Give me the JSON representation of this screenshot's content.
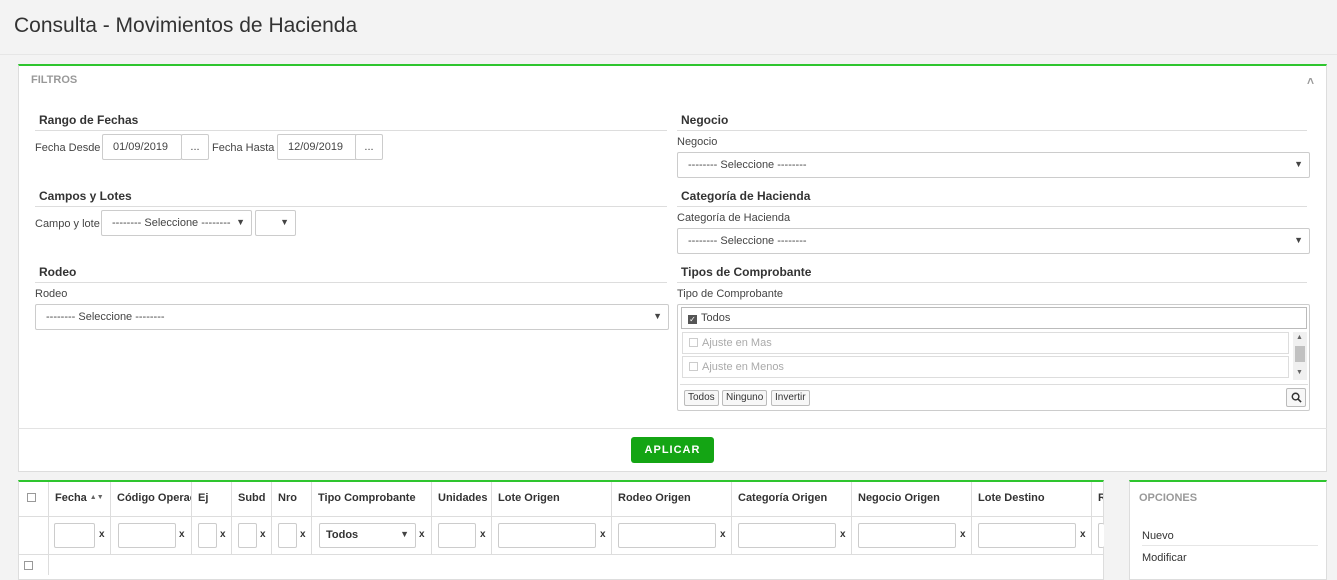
{
  "page": {
    "title": "Consulta - Movimientos de Hacienda"
  },
  "filters": {
    "header": "FILTROS",
    "rango": {
      "title": "Rango de Fechas",
      "desde_label": "Fecha Desde",
      "desde_value": "01/09/2019",
      "hasta_label": "Fecha Hasta",
      "hasta_value": "12/09/2019",
      "picker_label": "..."
    },
    "campos": {
      "title": "Campos y Lotes",
      "label": "Campo y lote",
      "campo_value": "-------- Seleccione --------",
      "lote_value": ""
    },
    "rodeo": {
      "title": "Rodeo",
      "label": "Rodeo",
      "value": "-------- Seleccione --------"
    },
    "negocio": {
      "title": "Negocio",
      "label": "Negocio",
      "value": "-------- Seleccione --------"
    },
    "categoria": {
      "title": "Categoría de Hacienda",
      "label": "Categoría de Hacienda",
      "value": "-------- Seleccione --------"
    },
    "tipos": {
      "title": "Tipos de Comprobante",
      "label": "Tipo de Comprobante",
      "todos_item": "Todos",
      "items": [
        "Ajuste en Mas",
        "Ajuste en Menos"
      ],
      "btn_todos": "Todos",
      "btn_ninguno": "Ninguno",
      "btn_invertir": "Invertir"
    },
    "apply_label": "APLICAR"
  },
  "grid": {
    "columns": [
      "Fecha",
      "Código Operación",
      "Ej",
      "Subd",
      "Nro",
      "Tipo Comprobante",
      "Unidades",
      "Lote Origen",
      "Rodeo Origen",
      "Categoría Origen",
      "Negocio Origen",
      "Lote Destino",
      "R"
    ],
    "tipo_filter_value": "Todos",
    "clear_label": "x"
  },
  "options": {
    "header": "OPCIONES",
    "items": [
      "Nuevo",
      "Modificar"
    ]
  },
  "colors": {
    "accent": "#2ec52e",
    "apply": "#14a514"
  }
}
